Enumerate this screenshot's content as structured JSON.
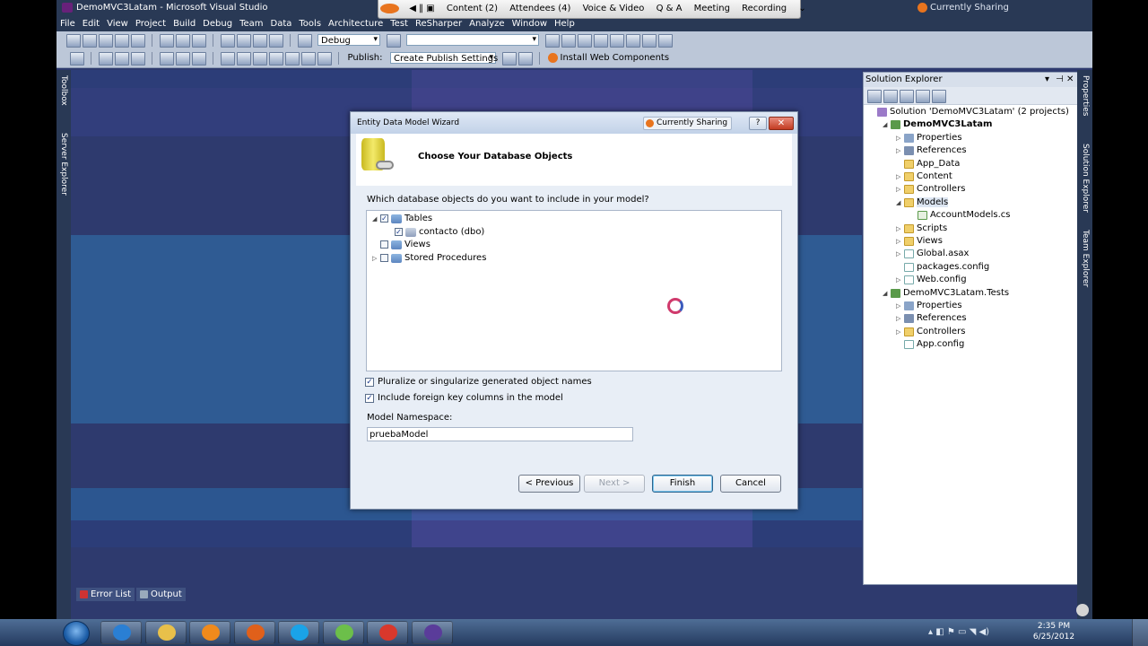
{
  "vs": {
    "title": "DemoMVC3Latam - Microsoft Visual Studio",
    "menu": [
      "File",
      "Edit",
      "View",
      "Project",
      "Build",
      "Debug",
      "Team",
      "Data",
      "Tools",
      "Architecture",
      "Test",
      "ReSharper",
      "Analyze",
      "Window",
      "Help"
    ],
    "config_combo": "Debug",
    "publish_label": "Publish:",
    "publish_combo": "Create Publish Settings",
    "install_web_components": "Install Web Components",
    "left_tabs": [
      "Toolbox",
      "Server Explorer"
    ],
    "right_tabs": [
      "Properties",
      "Solution Explorer",
      "Team Explorer"
    ],
    "bottom_tabs": [
      "Error List",
      "Output"
    ]
  },
  "share_toolbar": {
    "items": [
      "Content (2)",
      "Attendees (4)",
      "Voice & Video",
      "Q & A",
      "Meeting",
      "Recording"
    ],
    "status": "Currently Sharing"
  },
  "solution_explorer": {
    "title": "Solution Explorer",
    "items": [
      {
        "label": "Solution 'DemoMVC3Latam' (2 projects)",
        "icon": "solution-icon",
        "depth": 0,
        "tri": ""
      },
      {
        "label": "DemoMVC3Latam",
        "icon": "project-icon",
        "depth": 1,
        "tri": "◢",
        "bold": true
      },
      {
        "label": "Properties",
        "icon": "properties-icon",
        "depth": 2,
        "tri": "▷"
      },
      {
        "label": "References",
        "icon": "references-icon",
        "depth": 2,
        "tri": "▷"
      },
      {
        "label": "App_Data",
        "icon": "folder-icon",
        "depth": 2,
        "tri": ""
      },
      {
        "label": "Content",
        "icon": "folder-icon",
        "depth": 2,
        "tri": "▷"
      },
      {
        "label": "Controllers",
        "icon": "folder-icon",
        "depth": 2,
        "tri": "▷"
      },
      {
        "label": "Models",
        "icon": "folder-icon",
        "depth": 2,
        "tri": "◢",
        "selected": true
      },
      {
        "label": "AccountModels.cs",
        "icon": "csharp-file-icon",
        "depth": 3,
        "tri": ""
      },
      {
        "label": "Scripts",
        "icon": "folder-icon",
        "depth": 2,
        "tri": "▷"
      },
      {
        "label": "Views",
        "icon": "folder-icon",
        "depth": 2,
        "tri": "▷"
      },
      {
        "label": "Global.asax",
        "icon": "file-icon",
        "depth": 2,
        "tri": "▷"
      },
      {
        "label": "packages.config",
        "icon": "file-icon",
        "depth": 2,
        "tri": ""
      },
      {
        "label": "Web.config",
        "icon": "file-icon",
        "depth": 2,
        "tri": "▷"
      },
      {
        "label": "DemoMVC3Latam.Tests",
        "icon": "project-icon",
        "depth": 1,
        "tri": "◢"
      },
      {
        "label": "Properties",
        "icon": "properties-icon",
        "depth": 2,
        "tri": "▷"
      },
      {
        "label": "References",
        "icon": "references-icon",
        "depth": 2,
        "tri": "▷"
      },
      {
        "label": "Controllers",
        "icon": "folder-icon",
        "depth": 2,
        "tri": "▷"
      },
      {
        "label": "App.config",
        "icon": "file-icon",
        "depth": 2,
        "tri": ""
      }
    ]
  },
  "dialog": {
    "title": "Entity Data Model Wizard",
    "sharing": "Currently Sharing",
    "heading": "Choose Your Database Objects",
    "question": "Which database objects do you want to include in your model?",
    "tree": [
      {
        "label": "Tables",
        "depth": 0,
        "tri": "◢",
        "check": "✓"
      },
      {
        "label": "contacto (dbo)",
        "depth": 1,
        "tri": "",
        "check": "✓"
      },
      {
        "label": "Views",
        "depth": 0,
        "tri": "",
        "check": ""
      },
      {
        "label": "Stored Procedures",
        "depth": 0,
        "tri": "▷",
        "check": ""
      }
    ],
    "pluralize_label": "Pluralize or singularize generated object names",
    "pluralize_checked": true,
    "foreign_keys_label": "Include foreign key columns in the model",
    "foreign_keys_checked": true,
    "namespace_label": "Model Namespace:",
    "namespace_value": "pruebaModel",
    "buttons": {
      "previous": "< Previous",
      "next": "Next >",
      "finish": "Finish",
      "cancel": "Cancel"
    }
  },
  "taskbar": {
    "time": "2:35 PM",
    "date": "6/25/2012",
    "apps": [
      {
        "name": "internet-explorer-icon",
        "color": "#2a7fd4"
      },
      {
        "name": "file-explorer-icon",
        "color": "#e8c04a"
      },
      {
        "name": "media-player-icon",
        "color": "#f08a1c"
      },
      {
        "name": "firefox-icon",
        "color": "#e0601a"
      },
      {
        "name": "skype-icon",
        "color": "#1aa3e8"
      },
      {
        "name": "network-app-icon",
        "color": "#6cbf4a"
      },
      {
        "name": "chrome-icon",
        "color": "#d9382c"
      },
      {
        "name": "visual-studio-icon",
        "color": "#5a3c9a"
      }
    ]
  }
}
